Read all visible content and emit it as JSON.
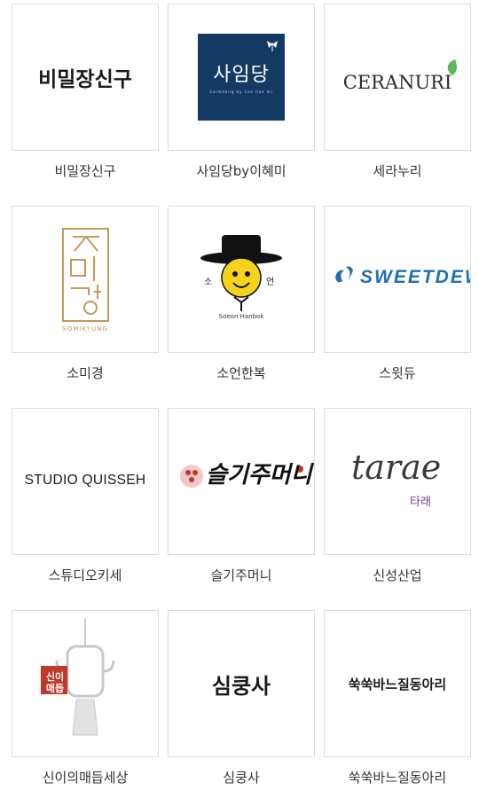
{
  "brands": [
    {
      "name": "비밀장신구",
      "logo_text": "비밀장신구"
    },
    {
      "name": "사임당by이혜미",
      "logo_text": "사임당",
      "logo_subtext": "Saimdang by Lee hae mi"
    },
    {
      "name": "세라누리",
      "logo_text": "CERANURI"
    },
    {
      "name": "소미경",
      "logo_subtext": "SOMIKYUNG"
    },
    {
      "name": "소언한복",
      "logo_left": "소",
      "logo_right": "언",
      "logo_subtext": "Soeon Hanbok"
    },
    {
      "name": "스윗듀",
      "logo_text": "SWEETDEW"
    },
    {
      "name": "스튜디오키세",
      "logo_text": "STUDIO QUISSEH"
    },
    {
      "name": "슬기주머니",
      "logo_text": "슬기주머니"
    },
    {
      "name": "신성산업",
      "logo_text": "tarae",
      "logo_subtext": "타래"
    },
    {
      "name": "신이의매듭세상",
      "logo_text": "신이매듭"
    },
    {
      "name": "심쿵사",
      "logo_text": "심쿵사"
    },
    {
      "name": "쑥쑥바느질동아리",
      "logo_text": "쑥쑥바느질동아리"
    }
  ]
}
